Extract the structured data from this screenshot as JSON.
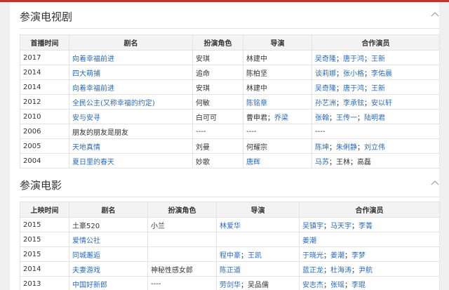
{
  "tv": {
    "title": "参演电视剧",
    "headers": [
      "首播时间",
      "剧名",
      "扮演角色",
      "导演",
      "合作演员"
    ],
    "rows": [
      {
        "year": "2017",
        "name": "向着幸福前进",
        "name_link": true,
        "role": "安琪",
        "director": [
          {
            "t": "林建中",
            "l": false
          }
        ],
        "costars": [
          {
            "t": "吴奇隆",
            "l": true
          },
          {
            "t": "唐于鸿",
            "l": true
          },
          {
            "t": "王新",
            "l": true
          }
        ]
      },
      {
        "year": "2014",
        "name": "四大萌捕",
        "name_link": true,
        "role": "追命",
        "director": [
          {
            "t": "陈柏坚",
            "l": false
          }
        ],
        "costars": [
          {
            "t": "谈莉娜",
            "l": true
          },
          {
            "t": "张小格",
            "l": true
          },
          {
            "t": "李佑晨",
            "l": true
          }
        ]
      },
      {
        "year": "2014",
        "name": "向着幸福前进",
        "name_link": true,
        "role": "安琪",
        "director": [
          {
            "t": "林建中",
            "l": false
          }
        ],
        "costars": [
          {
            "t": "吴奇隆",
            "l": true
          },
          {
            "t": "唐于鸿",
            "l": true
          },
          {
            "t": "王新",
            "l": true
          }
        ]
      },
      {
        "year": "2012",
        "name": "全民公主(又称幸福的约定)",
        "name_link": true,
        "role": "何敏",
        "director": [
          {
            "t": "陈铭章",
            "l": true
          }
        ],
        "costars": [
          {
            "t": "孙艺洲",
            "l": true
          },
          {
            "t": "李承铉",
            "l": true
          },
          {
            "t": "安以轩",
            "l": true
          }
        ]
      },
      {
        "year": "2010",
        "name": "安与安寻",
        "name_link": true,
        "role": "白可可",
        "director": [
          {
            "t": "曹申君",
            "l": false
          },
          {
            "t": "乔梁",
            "l": true
          }
        ],
        "costars": [
          {
            "t": "张翰",
            "l": true
          },
          {
            "t": "王传一",
            "l": true
          },
          {
            "t": "陆明君",
            "l": true
          }
        ]
      },
      {
        "year": "2006",
        "name": "朋友的朋友是朋友",
        "name_link": false,
        "role": "",
        "director": [],
        "costars": []
      },
      {
        "year": "2005",
        "name": "天地真情",
        "name_link": true,
        "role": "刘曼",
        "director": [
          {
            "t": "何耀宗",
            "l": false
          }
        ],
        "costars": [
          {
            "t": "陈坤",
            "l": true
          },
          {
            "t": "朱俐静",
            "l": true
          },
          {
            "t": "刘立伟",
            "l": true
          }
        ]
      },
      {
        "year": "2004",
        "name": "夏日里的春天",
        "name_link": true,
        "role": "妙歌",
        "director": [
          {
            "t": "唐辉",
            "l": true
          }
        ],
        "costars": [
          {
            "t": "马苏",
            "l": true
          },
          {
            "t": "王林",
            "l": false
          },
          {
            "t": "高磊",
            "l": false
          }
        ]
      }
    ],
    "placeholder": "----"
  },
  "film": {
    "title": "参演电影",
    "headers": [
      "上映时间",
      "剧名",
      "扮演角色",
      "导演",
      "合作演员"
    ],
    "rows": [
      {
        "year": "2015",
        "name": "土豪520",
        "name_link": false,
        "role": "小兰",
        "director": [
          {
            "t": "林爱华",
            "l": true
          }
        ],
        "costars": [
          {
            "t": "吴镇宇",
            "l": true
          },
          {
            "t": "马天宇",
            "l": true
          },
          {
            "t": "李菁",
            "l": true
          }
        ]
      },
      {
        "year": "2015",
        "name": "爱情公社",
        "name_link": true,
        "role": "",
        "director": [],
        "costars": [
          {
            "t": "姜潮",
            "l": true
          }
        ]
      },
      {
        "year": "2015",
        "name": "同城邂逅",
        "name_link": true,
        "role": "",
        "director": [
          {
            "t": "程中豪",
            "l": true
          },
          {
            "t": "王凯",
            "l": true
          }
        ],
        "costars": [
          {
            "t": "于晓光",
            "l": true
          },
          {
            "t": "姜潮",
            "l": true
          },
          {
            "t": "李梦",
            "l": true
          }
        ]
      },
      {
        "year": "2014",
        "name": "夫妻游戏",
        "name_link": true,
        "role": "神秘性感女郎",
        "director": [
          {
            "t": "陈正道",
            "l": true
          }
        ],
        "costars": [
          {
            "t": "蓝正龙",
            "l": true
          },
          {
            "t": "杜海涛",
            "l": true
          },
          {
            "t": "尹航",
            "l": true
          }
        ]
      },
      {
        "year": "2013",
        "name": "中国好新郎",
        "name_link": true,
        "role": "----",
        "director": [
          {
            "t": "劳剑华",
            "l": true
          },
          {
            "t": "吴品儒",
            "l": false
          }
        ],
        "costars": [
          {
            "t": "安志杰",
            "l": true
          },
          {
            "t": "张瑶",
            "l": true
          },
          {
            "t": "李琨",
            "l": true
          }
        ]
      }
    ]
  },
  "icons": {
    "collapse": "chevron-up-icon"
  },
  "colors": {
    "link": "#2a6bb8",
    "accent": "#c9302c",
    "header_bg": "#f3f3f3"
  }
}
